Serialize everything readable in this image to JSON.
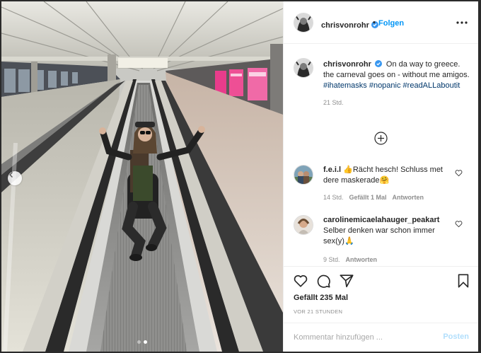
{
  "post": {
    "author": "chrisvonrohr",
    "follow_label": "Folgen",
    "separator": "•",
    "more_icon": "more-horizontal-icon",
    "verified_icon": "verified-badge-icon",
    "caption": {
      "author": "chrisvonrohr",
      "text": "On da way to greece. the carneval goes on - without me amigos.",
      "hashtags": [
        "#ihatemasks",
        "#nopanic",
        "#readALLaboutit"
      ],
      "time": "21 Std."
    },
    "load_more_icon": "plus-circle-icon",
    "comments": [
      {
        "author": "f.e.i.l",
        "text": "👍Rächt hesch! Schluss met dere maskerade🤗",
        "time": "14 Std.",
        "likes": "Gefällt 1 Mal",
        "reply": "Antworten"
      },
      {
        "author": "carolinemicaelahauger_peakart",
        "text": "Selber denken war schon immer sex(y)🙏",
        "time": "9 Std.",
        "reply": "Antworten"
      }
    ],
    "likes_text": "Gefällt 235 Mal",
    "time_ago": "VOR 21 STUNDEN",
    "comment_placeholder": "Kommentar hinzufügen ...",
    "post_label": "Posten"
  },
  "carousel": {
    "total": 2,
    "active": 2
  },
  "colors": {
    "accent": "#0095f6",
    "verified": "#3897f0",
    "hashtag": "#00376b",
    "meta": "#8e8e8e"
  }
}
